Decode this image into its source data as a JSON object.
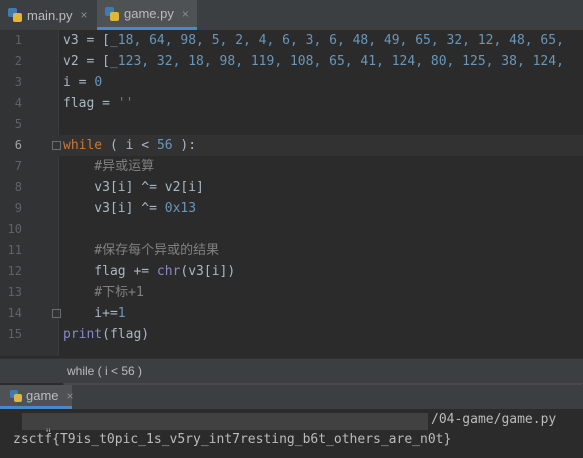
{
  "tabs": [
    {
      "label": "main.py",
      "close": "×",
      "icon": "python-file-icon"
    },
    {
      "label": "game.py",
      "close": "×",
      "icon": "python-file-icon"
    }
  ],
  "editor": {
    "line_numbers": [
      "1",
      "2",
      "3",
      "4",
      "5",
      "6",
      "7",
      "8",
      "9",
      "10",
      "11",
      "12",
      "13",
      "14",
      "15"
    ],
    "current_line": "6",
    "lines": [
      {
        "parts": [
          [
            "t",
            "v3 = ["
          ],
          [
            "num",
            "_18, 64, 98, 5, 2, 4, 6, 3, 6, 48, 49, 65, 32, 12, 48, 65,"
          ]
        ]
      },
      {
        "parts": [
          [
            "t",
            "v2 = ["
          ],
          [
            "num",
            "_123, 32, 18, 98, 119, 108, 65, 41, 124, 80, 125, 38, 124,"
          ]
        ]
      },
      {
        "parts": [
          [
            "t",
            "i = "
          ],
          [
            "num",
            "0"
          ]
        ]
      },
      {
        "parts": [
          [
            "t",
            "flag = "
          ],
          [
            "str",
            "''"
          ]
        ]
      },
      {
        "parts": []
      },
      {
        "parts": [
          [
            "kw",
            "while"
          ],
          [
            "t",
            " ( i < "
          ],
          [
            "num",
            "56"
          ],
          [
            "t",
            " ):"
          ]
        ]
      },
      {
        "parts": [
          [
            "cm",
            "    #异或运算"
          ]
        ]
      },
      {
        "parts": [
          [
            "t",
            "    v3[i] ^= v2[i]"
          ]
        ]
      },
      {
        "parts": [
          [
            "t",
            "    v3[i] ^= "
          ],
          [
            "num",
            "0x13"
          ]
        ]
      },
      {
        "parts": []
      },
      {
        "parts": [
          [
            "cm",
            "    #保存每个异或的结果"
          ]
        ]
      },
      {
        "parts": [
          [
            "t",
            "    flag += "
          ],
          [
            "bi",
            "chr"
          ],
          [
            "t",
            "(v3[i])"
          ]
        ]
      },
      {
        "parts": [
          [
            "cm",
            "    #下标+1"
          ]
        ]
      },
      {
        "parts": [
          [
            "t",
            "    i+="
          ],
          [
            "num",
            "1"
          ]
        ]
      },
      {
        "parts": [
          [
            "bi",
            "print"
          ],
          [
            "t",
            "(flag)"
          ]
        ]
      }
    ]
  },
  "breadcrumb": "while ( i < 56 )",
  "run": {
    "tab_label": "game",
    "tab_close": "×",
    "console_path_prefix": "\"",
    "console_path_suffix": "/04-game/game.py",
    "console_output": "zsctf{T9is_t0pic_1s_v5ry_int7resting_b6t_others_are_n0t}"
  }
}
